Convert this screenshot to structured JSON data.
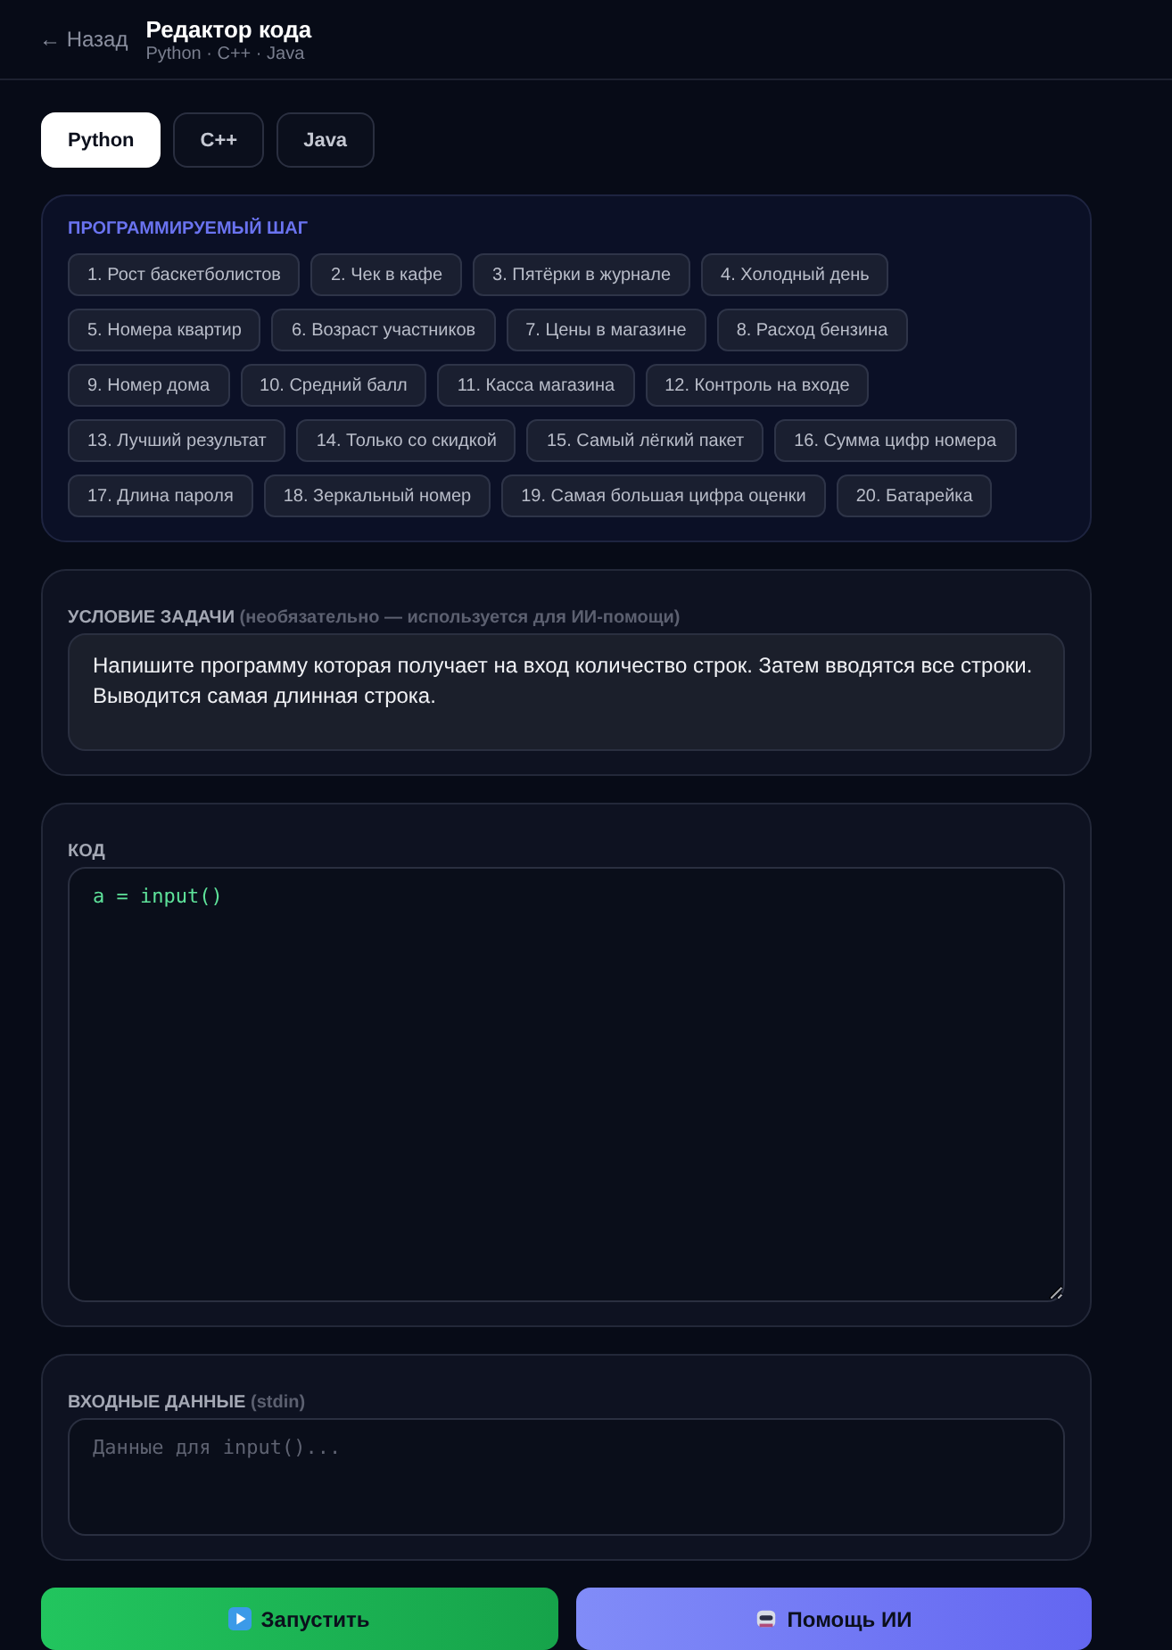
{
  "header": {
    "back": "← Назад",
    "title": "Редактор кода",
    "subtitle": "Python · C++ · Java"
  },
  "languages": [
    {
      "label": "Python",
      "selected": true
    },
    {
      "label": "C++",
      "selected": false
    },
    {
      "label": "Java",
      "selected": false
    }
  ],
  "steps": {
    "heading": "ПРОГРАММИРУЕМЫЙ ШАГ",
    "items": [
      "1. Рост баскетболистов",
      "2. Чек в кафе",
      "3. Пятёрки в журнале",
      "4. Холодный день",
      "5. Номера квартир",
      "6. Возраст участников",
      "7. Цены в магазине",
      "8. Расход бензина",
      "9. Номер дома",
      "10. Средний балл",
      "11. Касса магазина",
      "12. Контроль на входе",
      "13. Лучший результат",
      "14. Только со скидкой",
      "15. Самый лёгкий пакет",
      "16. Сумма цифр номера",
      "17. Длина пароля",
      "18. Зеркальный номер",
      "19. Самая большая цифра оценки",
      "20. Батарейка"
    ]
  },
  "condition": {
    "label": "УСЛОВИЕ ЗАДАЧИ",
    "hint": "(необязательно — используется для ИИ-помощи)",
    "value": "Напишите программу которая получает на вход количество строк. Затем вводятся все строки. Выводится самая длинная строка."
  },
  "code": {
    "label": "КОД",
    "value": "a = input()"
  },
  "stdin": {
    "label": "ВХОДНЫЕ ДАННЫЕ",
    "hint": "(stdin)",
    "placeholder": "Данные для input()..."
  },
  "buttons": [
    {
      "kind": "run",
      "label": "Запустить"
    },
    {
      "kind": "ai",
      "label": "Помощь ИИ"
    }
  ]
}
